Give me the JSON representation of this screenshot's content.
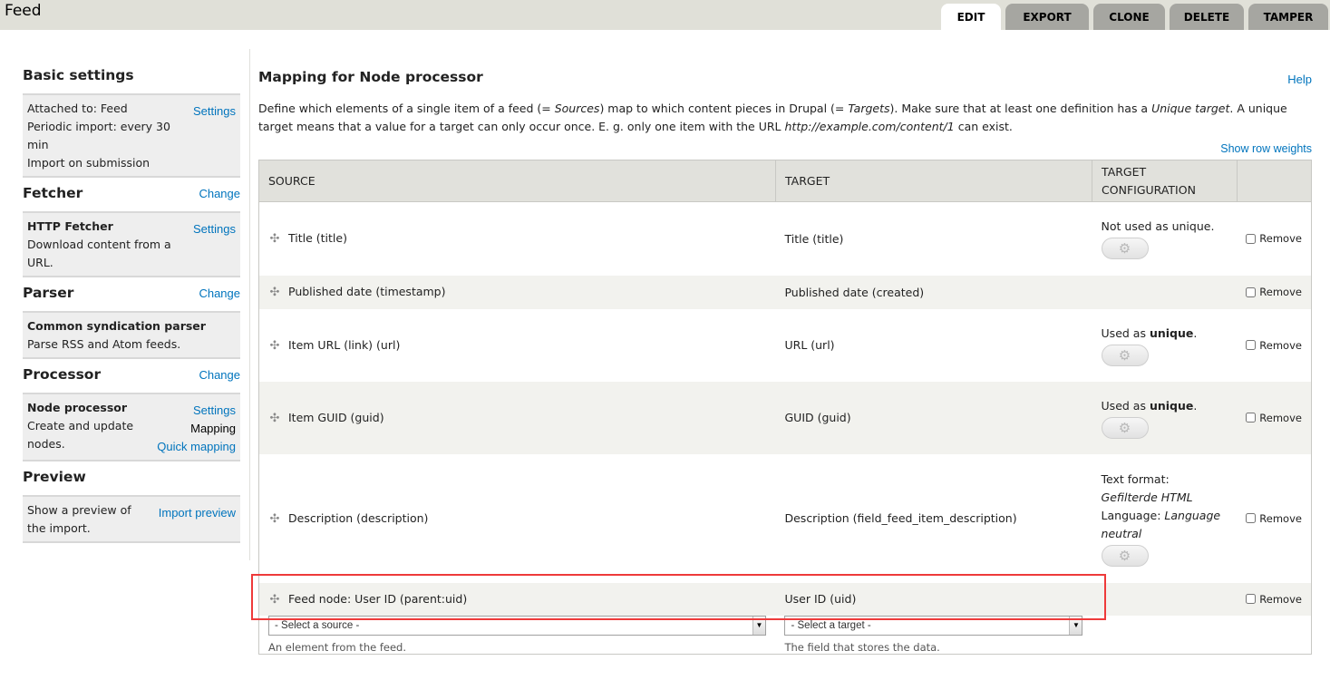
{
  "header": {
    "title": "Feed",
    "tabs": [
      {
        "label": "EDIT",
        "active": true
      },
      {
        "label": "EXPORT",
        "active": false
      },
      {
        "label": "CLONE",
        "active": false
      },
      {
        "label": "DELETE",
        "active": false
      },
      {
        "label": "TAMPER",
        "active": false
      }
    ]
  },
  "sidebar": {
    "basic": {
      "title": "Basic settings",
      "lines": [
        "Attached to: Feed",
        "Periodic import: every 30 min",
        "Import on submission"
      ],
      "action": "Settings"
    },
    "fetcher": {
      "title": "Fetcher",
      "change": "Change",
      "name": "HTTP Fetcher",
      "description": "Download content from a URL.",
      "action": "Settings"
    },
    "parser": {
      "title": "Parser",
      "change": "Change",
      "name": "Common syndication parser",
      "description": "Parse RSS and Atom feeds."
    },
    "processor": {
      "title": "Processor",
      "change": "Change",
      "name": "Node processor",
      "description": "Create and update nodes.",
      "actions": {
        "settings": "Settings",
        "mapping": "Mapping",
        "quick_mapping": "Quick mapping"
      }
    },
    "preview": {
      "title": "Preview",
      "description": "Show a preview of the import.",
      "action": "Import preview"
    }
  },
  "main": {
    "title": "Mapping for Node processor",
    "help": "Help",
    "intro": {
      "p1": "Define which elements of a single item of a feed (= ",
      "sources": "Sources",
      "p2": ") map to which content pieces in Drupal (= ",
      "targets": "Targets",
      "p3": "). Make sure that at least one definition has a ",
      "unique_target": "Unique target",
      "p4": ". A unique target means that a value for a target can only occur once. E. g. only one item with the URL ",
      "url": "http://example.com/content/1",
      "p5": " can exist."
    },
    "show_row_weights": "Show row weights",
    "columns": [
      "SOURCE",
      "TARGET",
      "TARGET CONFIGURATION",
      ""
    ],
    "remove_label": "Remove",
    "rows": [
      {
        "source": "Title (title)",
        "target": "Title (title)",
        "config_pre": "Not used as unique.",
        "config_bold": "",
        "config_post": "",
        "has_gear": true
      },
      {
        "source": "Published date (timestamp)",
        "target": "Published date (created)",
        "config_pre": "",
        "config_bold": "",
        "config_post": "",
        "has_gear": false
      },
      {
        "source": "Item URL (link) (url)",
        "target": "URL (url)",
        "config_pre": "Used as ",
        "config_bold": "unique",
        "config_post": ".",
        "has_gear": true
      },
      {
        "source": "Item GUID (guid)",
        "target": "GUID (guid)",
        "config_pre": "Used as ",
        "config_bold": "unique",
        "config_post": ".",
        "has_gear": true
      },
      {
        "source": "Description (description)",
        "target": "Description (field_feed_item_description)",
        "text_format_label": "Text format: ",
        "text_format": "Gefilterde HTML",
        "language_label": "Language: ",
        "language": "Language neutral",
        "has_gear": true
      },
      {
        "source": "Feed node: User ID (parent:uid)",
        "target": "User ID (uid)",
        "config_pre": "",
        "config_bold": "",
        "config_post": "",
        "has_gear": false
      }
    ],
    "add": {
      "source_select": "- Select a source -",
      "source_hint": "An element from the feed.",
      "target_select": "- Select a target -",
      "target_hint": "The field that stores the data."
    }
  },
  "colors": {
    "link": "#0074bd",
    "header_bg": "#e0e0d8",
    "tab_inactive": "#a6a6a1",
    "highlight": "#ee3a3a"
  }
}
